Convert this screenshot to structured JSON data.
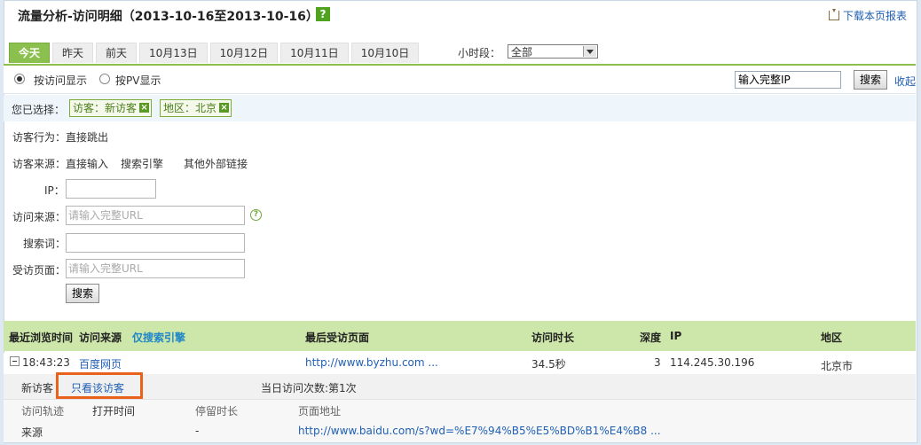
{
  "header": {
    "title": "流量分析-访问明细（2013-10-16至2013-10-16）",
    "help": "?",
    "download": "下载本页报表"
  },
  "tabs": [
    "今天",
    "昨天",
    "前天",
    "10月13日",
    "10月12日",
    "10月11日",
    "10月10日"
  ],
  "hour": {
    "label": "小时段：",
    "value": "全部"
  },
  "mode": {
    "by_visit": "按访问显示",
    "by_pv": "按PV显示",
    "ip_value": "输入完整IP",
    "search": "搜索",
    "collapse": "收起"
  },
  "selected": {
    "label": "您已选择：",
    "chips": [
      "访客：新访客",
      "地区：北京"
    ]
  },
  "filters": {
    "behavior_label": "访客行为：",
    "behavior_link": "直接跳出",
    "source_label": "访客来源：",
    "source_links": [
      "直接输入",
      "搜索引擎",
      "其他外部链接"
    ],
    "ip_label": "IP：",
    "ref_label": "访问来源：",
    "ref_placeholder": "请输入完整URL",
    "keyword_label": "搜索词：",
    "page_label": "受访页面：",
    "page_placeholder": "请输入完整URL",
    "search_button": "搜索"
  },
  "table": {
    "headers": {
      "last_time": "最近浏览时间",
      "source": "访问来源",
      "search_only": "仅搜索引擎",
      "last_page": "最后受访页面",
      "duration": "访问时长",
      "depth": "深度",
      "ip": "IP",
      "region": "地区"
    },
    "rows": [
      {
        "time": "18:43:23",
        "source": "百度网页",
        "last_page": "http://www.byzhu.com ...",
        "duration": "34.5秒",
        "depth": "3",
        "ip": "114.245.30.196",
        "region": "北京市"
      }
    ],
    "detail": {
      "visitor_type": "新访客",
      "view_only": "只看该访客",
      "visits_today": "当日访问次数:第1次"
    },
    "track_headers": {
      "track": "访问轨迹",
      "open_time": "打开时间",
      "stay": "停留时长",
      "url": "页面地址"
    },
    "track_rows": [
      {
        "track": "来源",
        "open_time": "",
        "stay": "-",
        "url": "http://www.baidu.com/s?wd=%E7%94%B5%E5%BD%B1%E4%B8 ..."
      }
    ]
  },
  "colors": {
    "accent_green": "#8cc04e",
    "header_green": "#cde6a9",
    "link_blue": "#1f5fb4",
    "highlight_orange": "#e8621b"
  }
}
